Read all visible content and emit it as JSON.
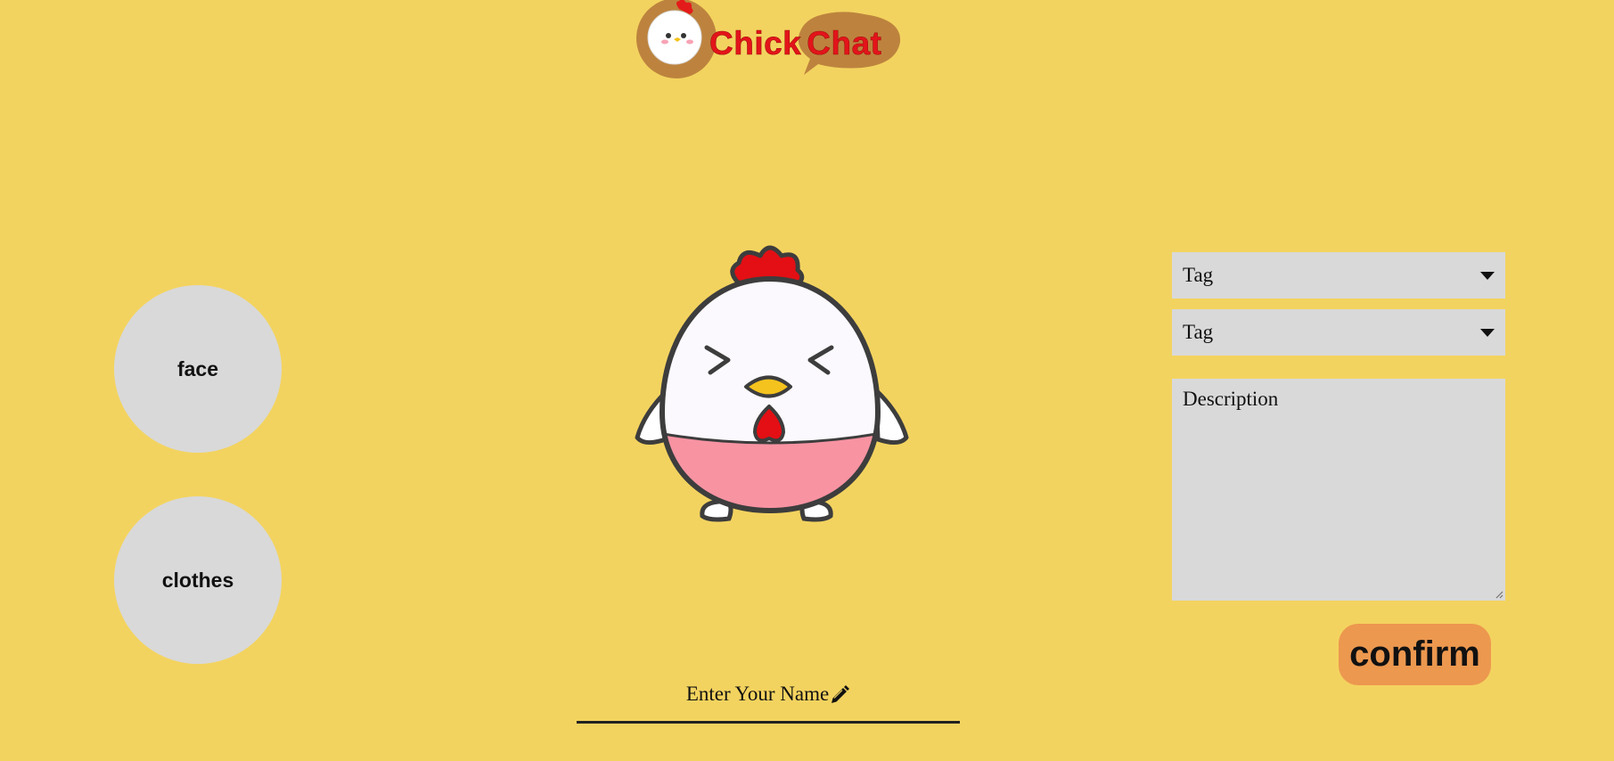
{
  "header": {
    "logo_word1": "Chick",
    "logo_word2": "Chat"
  },
  "side_buttons": {
    "face": "face",
    "clothes": "clothes"
  },
  "form": {
    "tag1": "Tag",
    "tag2": "Tag",
    "description_placeholder": "Description",
    "confirm": "confirm",
    "name_placeholder": "Enter Your Name"
  },
  "icons": {
    "dropdown": "caret-down-icon",
    "edit": "pencil-icon"
  },
  "colors": {
    "background": "#f3d35f",
    "button_gray": "#d9d9d9",
    "confirm": "#ec984f",
    "logo_red": "#e3141a",
    "logo_brown": "#bd833e"
  }
}
